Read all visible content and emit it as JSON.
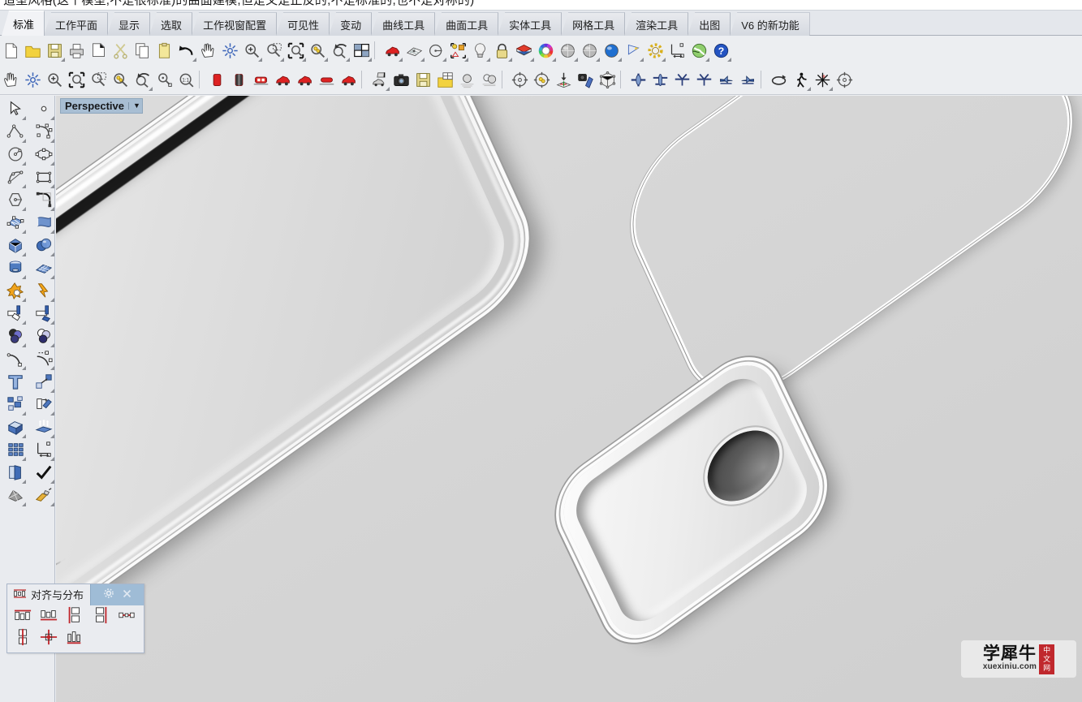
{
  "window": {
    "clipped_top_text": "造型风格(这个模型,不是很标准)的曲面建模,但是又是正反的,不是标准的,也不是对称的)"
  },
  "tabbar": {
    "active_index": 0,
    "tabs": [
      {
        "label": "标准"
      },
      {
        "label": "工作平面"
      },
      {
        "label": "显示"
      },
      {
        "label": "选取"
      },
      {
        "label": "工作视窗配置"
      },
      {
        "label": "可见性"
      },
      {
        "label": "变动"
      },
      {
        "label": "曲线工具"
      },
      {
        "label": "曲面工具"
      },
      {
        "label": "实体工具"
      },
      {
        "label": "网格工具"
      },
      {
        "label": "渲染工具"
      },
      {
        "label": "出图"
      },
      {
        "label": "V6 的新功能"
      }
    ]
  },
  "toolbar_row1": {
    "items": [
      {
        "icon": "new-file-icon",
        "flyout": false
      },
      {
        "icon": "open-folder-icon",
        "flyout": false
      },
      {
        "icon": "save-icon",
        "flyout": true
      },
      {
        "icon": "print-icon",
        "flyout": false
      },
      {
        "icon": "copy-to-clipboard-icon",
        "flyout": false
      },
      {
        "icon": "cut-scissors-icon",
        "flyout": false
      },
      {
        "icon": "copy-icon",
        "flyout": false
      },
      {
        "icon": "paste-clipboard-icon",
        "flyout": false
      },
      {
        "icon": "undo-icon",
        "flyout": true
      },
      {
        "icon": "pan-hand-icon",
        "flyout": false
      },
      {
        "icon": "rotate-view-icon",
        "flyout": false
      },
      {
        "icon": "zoom-in-icon",
        "flyout": true
      },
      {
        "icon": "zoom-window-icon",
        "flyout": true
      },
      {
        "icon": "zoom-extents-icon",
        "flyout": true
      },
      {
        "icon": "zoom-selected-icon",
        "flyout": true
      },
      {
        "icon": "zoom-previous-icon",
        "flyout": true
      },
      {
        "icon": "viewport-layout-icon",
        "flyout": true
      },
      {
        "divider": true
      },
      {
        "icon": "shaded-car-icon",
        "flyout": true
      },
      {
        "icon": "grid-plane-icon",
        "flyout": true
      },
      {
        "icon": "circle-radius-icon",
        "flyout": true
      },
      {
        "icon": "object-properties-icon",
        "flyout": true
      },
      {
        "icon": "light-bulb-icon",
        "flyout": true
      },
      {
        "icon": "lock-icon",
        "flyout": true
      },
      {
        "icon": "layers-stack-icon",
        "flyout": true
      },
      {
        "icon": "color-wheel-icon",
        "flyout": true
      },
      {
        "icon": "sphere-shaded-icon",
        "flyout": true
      },
      {
        "icon": "sphere-ghosted-icon",
        "flyout": true
      },
      {
        "icon": "sphere-rendered-icon",
        "flyout": true
      },
      {
        "icon": "flag-select-icon",
        "flyout": true
      },
      {
        "icon": "gear-options-icon",
        "flyout": true
      },
      {
        "icon": "dimension-icon",
        "flyout": false
      },
      {
        "icon": "globe-earth-icon",
        "flyout": true
      },
      {
        "icon": "help-question-icon",
        "flyout": true
      }
    ]
  },
  "toolbar_row2": {
    "items": [
      {
        "icon": "pan-hand-icon",
        "flyout": false
      },
      {
        "icon": "rotate-view-icon",
        "flyout": false
      },
      {
        "icon": "zoom-in-out-icon",
        "flyout": false
      },
      {
        "icon": "zoom-extents-icon",
        "flyout": false
      },
      {
        "icon": "zoom-window-icon",
        "flyout": false
      },
      {
        "icon": "zoom-selected-icon",
        "flyout": false
      },
      {
        "icon": "zoom-previous-icon",
        "flyout": true
      },
      {
        "icon": "zoom-target-icon",
        "flyout": false
      },
      {
        "icon": "zoom-one-to-one-icon",
        "flyout": false
      },
      {
        "divider": true
      },
      {
        "icon": "view-front-car-icon",
        "flyout": false
      },
      {
        "icon": "view-back-car-icon",
        "flyout": false
      },
      {
        "icon": "view-top-car-icon",
        "flyout": false
      },
      {
        "icon": "view-right-car-icon",
        "flyout": false
      },
      {
        "icon": "view-left-car-icon",
        "flyout": false
      },
      {
        "icon": "view-bottom-car-icon",
        "flyout": false
      },
      {
        "icon": "view-perspective-car-icon",
        "flyout": false
      },
      {
        "divider": true
      },
      {
        "icon": "set-camera-car-icon",
        "flyout": true
      },
      {
        "icon": "camera-icon",
        "flyout": false
      },
      {
        "icon": "save-view-car-icon",
        "flyout": false
      },
      {
        "icon": "named-views-folder-icon",
        "flyout": false
      },
      {
        "icon": "sphere-ground-icon",
        "flyout": false
      },
      {
        "icon": "two-spheres-ground-icon",
        "flyout": false
      },
      {
        "divider": true
      },
      {
        "icon": "target-crosshair-icon",
        "flyout": false
      },
      {
        "icon": "target-point-icon",
        "flyout": false
      },
      {
        "icon": "place-target-icon",
        "flyout": false
      },
      {
        "icon": "camera-plane-icon",
        "flyout": false
      },
      {
        "icon": "cube-view-icon",
        "flyout": false
      },
      {
        "divider": true
      },
      {
        "icon": "plane-front-icon",
        "flyout": false
      },
      {
        "icon": "plane-top-icon",
        "flyout": false
      },
      {
        "icon": "plane-tilt-left-icon",
        "flyout": false
      },
      {
        "icon": "plane-tilt-right-icon",
        "flyout": false
      },
      {
        "icon": "plane-side-left-icon",
        "flyout": false
      },
      {
        "icon": "plane-side-right-icon",
        "flyout": false
      },
      {
        "divider": true
      },
      {
        "icon": "rotate-loop-icon",
        "flyout": false
      },
      {
        "icon": "walk-person-icon",
        "flyout": true
      },
      {
        "icon": "sun-star-icon",
        "flyout": true
      },
      {
        "icon": "target-circle-icon",
        "flyout": false
      }
    ]
  },
  "sidebar": {
    "items": [
      {
        "icon": "select-arrow-icon",
        "flyout": true
      },
      {
        "icon": "point-object-icon",
        "flyout": true
      },
      {
        "icon": "polyline-icon",
        "flyout": true
      },
      {
        "icon": "control-point-curve-icon",
        "flyout": true
      },
      {
        "icon": "circle-center-radius-icon",
        "flyout": true
      },
      {
        "icon": "ellipse-icon",
        "flyout": true
      },
      {
        "icon": "arc-icon",
        "flyout": true
      },
      {
        "icon": "rectangle-icon",
        "flyout": true
      },
      {
        "icon": "polygon-icon",
        "flyout": true
      },
      {
        "icon": "curve-fillet-icon",
        "flyout": true
      },
      {
        "icon": "surface-control-points-icon",
        "flyout": true
      },
      {
        "icon": "surface-loft-icon",
        "flyout": true
      },
      {
        "icon": "box-solid-icon",
        "flyout": true
      },
      {
        "icon": "boolean-spheres-icon",
        "flyout": true
      },
      {
        "icon": "cylinder-cap-icon",
        "flyout": true
      },
      {
        "icon": "mesh-plane-icon",
        "flyout": true
      },
      {
        "icon": "boolean-union-star-icon",
        "flyout": true
      },
      {
        "icon": "explode-lightning-icon",
        "flyout": true
      },
      {
        "icon": "trim-icon",
        "flyout": true
      },
      {
        "icon": "split-icon",
        "flyout": true
      },
      {
        "icon": "boolean-circles-icon",
        "flyout": true
      },
      {
        "icon": "boolean-difference-circles-icon",
        "flyout": true
      },
      {
        "icon": "extend-curve-icon",
        "flyout": true
      },
      {
        "icon": "blend-curve-icon",
        "flyout": true
      },
      {
        "icon": "text-tool-icon",
        "flyout": false
      },
      {
        "icon": "transform-move-icon",
        "flyout": true
      },
      {
        "icon": "group-objects-icon",
        "flyout": true
      },
      {
        "icon": "scale-object-icon",
        "flyout": true
      },
      {
        "icon": "extrude-box-icon",
        "flyout": true
      },
      {
        "icon": "array-lift-icon",
        "flyout": true
      },
      {
        "icon": "array-grid-icon",
        "flyout": true
      },
      {
        "icon": "dimension-linear-icon",
        "flyout": true
      },
      {
        "icon": "layers-panel-icon",
        "flyout": true
      },
      {
        "icon": "check-object-icon",
        "flyout": true
      },
      {
        "icon": "mesh-object-icon",
        "flyout": true
      },
      {
        "icon": "render-material-icon",
        "flyout": true
      }
    ]
  },
  "viewport": {
    "label": "Perspective",
    "caret": "▼",
    "background_color": "#d6d6d6"
  },
  "align_panel": {
    "tab_label": "对齐与分布",
    "tab_icon": "align-icon",
    "gear_icon": "gear-icon",
    "close_icon": "close-icon",
    "header_bg": "#9fbcd6",
    "buttons": [
      {
        "icon": "align-left-icon"
      },
      {
        "icon": "align-right-icon"
      },
      {
        "icon": "align-top-icon"
      },
      {
        "icon": "align-bottom-icon"
      },
      {
        "icon": "distribute-horizontal-icon"
      },
      {
        "icon": "align-vertical-center-icon"
      },
      {
        "icon": "align-horizontal-center-icon"
      },
      {
        "icon": "distribute-vertical-icon"
      }
    ]
  },
  "watermark": {
    "title": "学犀牛",
    "url": "xuexiniu.com",
    "badge_line1": "中",
    "badge_line2": "文",
    "badge_line3": "网",
    "badge_color": "#c0282d"
  }
}
